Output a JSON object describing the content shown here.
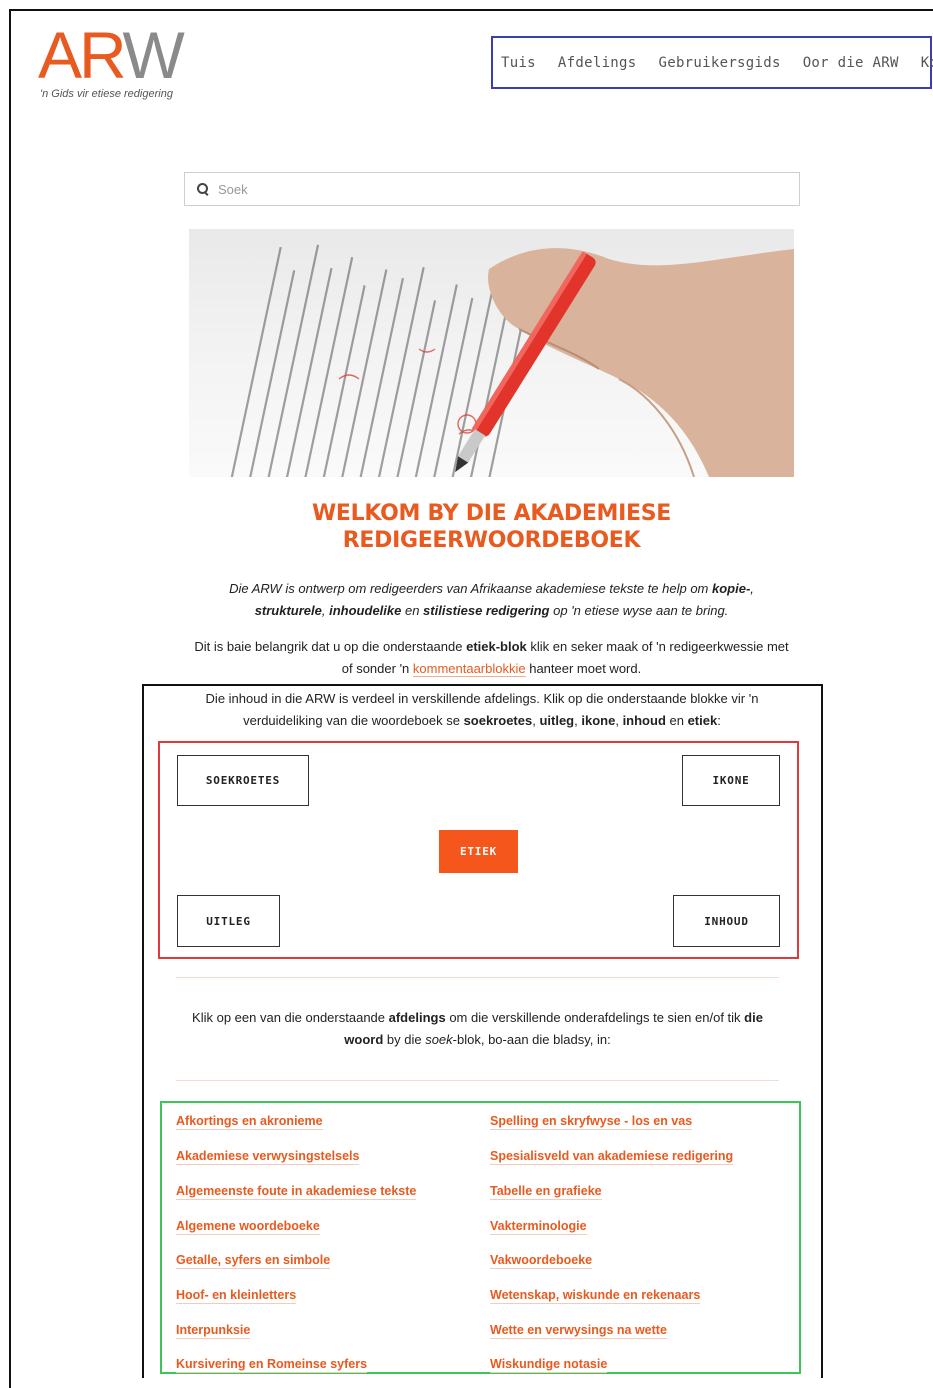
{
  "logo": {
    "text_a": "AR",
    "text_b": "W",
    "tagline": "'n Gids vir etiese redigering"
  },
  "nav": {
    "items": [
      "Tuis",
      "Afdelings",
      "Gebruikersgids",
      "Oor die ARW",
      "Kontak"
    ]
  },
  "search": {
    "placeholder": "Soek"
  },
  "headline": {
    "line1": "WELKOM BY DIE AKADEMIESE",
    "line2": "REDIGEERWOORDEBOEK"
  },
  "intro": {
    "p1_a": "Die ARW is ontwerp om redigeerders van Afrikaanse akademiese tekste te help om ",
    "p1_kopie": "kopie-",
    "p1_comma": ",",
    "p1_strukturele": "strukturele",
    "p1_sep1": ", ",
    "p1_inhoudelike": "inhoudelike",
    "p1_en": " en ",
    "p1_stilistiese": "stilistiese redigering",
    "p1_end": " op 'n etiese wyse aan te bring.",
    "p2_a": "Dit is baie belangrik dat u op die onderstaande ",
    "p2_bold": "etiek-blok",
    "p2_b": " klik en seker maak of 'n redigeerkwessie met of sonder 'n ",
    "p2_link": "kommentaarblokkie",
    "p2_c": " hanteer moet word."
  },
  "section": {
    "p_a": "Die inhoud in die ARW is verdeel in verskillende afdelings. Klik op die onderstaande blokke vir 'n verduideliking van die woordeboek se ",
    "soekroetes": "soekroetes",
    "sep1": ", ",
    "uitleg": "uitleg",
    "sep2": ", ",
    "ikone": "ikone",
    "sep3": ", ",
    "inhoud": "inhoud",
    "en": " en ",
    "etiek": "etiek",
    "colon": ":",
    "buttons": {
      "soekroetes": "SOEKROETES",
      "ikone": "IKONE",
      "etiek": "ETIEK",
      "uitleg": "UITLEG",
      "inhoud": "INHOUD"
    },
    "p2_a": "Klik op een van die onderstaande ",
    "p2_bold1": "afdelings",
    "p2_b": " om die verskillende onderafdelings te sien en/of tik ",
    "p2_bold2": "die woord",
    "p2_c": " by die ",
    "p2_em": "soek",
    "p2_d": "-blok, bo-aan die bladsy, in:"
  },
  "departments": {
    "left": [
      "Afkortings en akronieme",
      "Akademiese verwysingstelsels",
      "Algemeenste foute in akademiese tekste",
      "Algemene woordeboeke",
      "Getalle, syfers en simbole",
      "Hoof- en kleinletters",
      "Interpunksie",
      "Kursivering en Romeinse syfers"
    ],
    "right": [
      "Spelling en skryfwyse - los en vas",
      "Spesialisveld van akademiese redigering",
      "Tabelle en grafieke",
      "Vakterminologie",
      "Vakwoordeboeke",
      "Wetenskap, wiskunde en rekenaars",
      "Wette en verwysings na wette",
      "Wiskundige notasie"
    ]
  },
  "colors": {
    "accent": "#e85a1f",
    "button_primary": "#f5561c",
    "nav_border": "#3a3fb0",
    "red_box": "#e23a3a",
    "green_box": "#3ec55a"
  }
}
